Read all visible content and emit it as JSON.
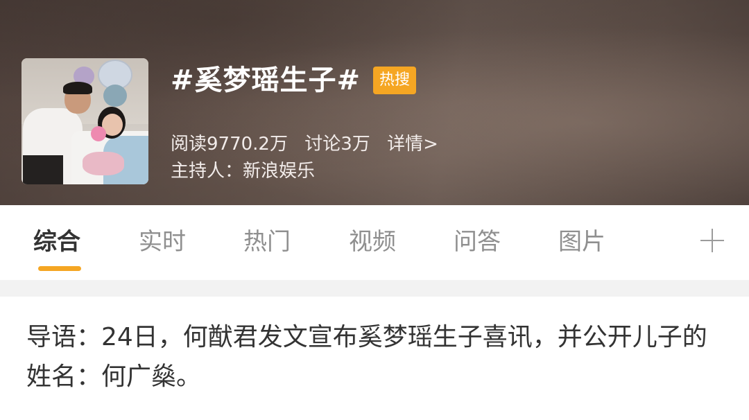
{
  "header": {
    "cover_alt": "cover photo",
    "title": "#奚梦瑶生子#",
    "hot_badge": "热搜",
    "stats": {
      "reads": "阅读9770.2万",
      "discussions": "讨论3万",
      "details_link": "详情>"
    },
    "host": "主持人：新浪娱乐"
  },
  "tabs": [
    {
      "label": "综合",
      "active": true
    },
    {
      "label": "实时",
      "active": false
    },
    {
      "label": "热门",
      "active": false
    },
    {
      "label": "视频",
      "active": false
    },
    {
      "label": "问答",
      "active": false
    },
    {
      "label": "图片",
      "active": false
    }
  ],
  "tab_add_icon": "plus-icon",
  "intro_text": "导语：24日，何猷君发文宣布奚梦瑶生子喜讯，并公开儿子的姓名：何广燊。",
  "colors": {
    "accent": "#f5a623",
    "active_tab_text": "#333333",
    "inactive_tab_text": "#8f8f8f"
  }
}
